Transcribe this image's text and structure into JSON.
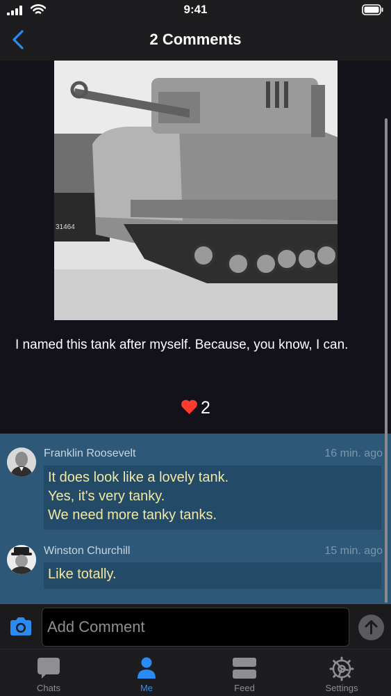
{
  "status_bar": {
    "time": "9:41"
  },
  "nav": {
    "title": "2 Comments"
  },
  "post": {
    "text": "I named this tank after myself. Because, you know, I can.",
    "like_count": "2",
    "image_text": "31464"
  },
  "comments": [
    {
      "author": "Franklin Roosevelt",
      "time": "16 min. ago",
      "lines": [
        "It does look like a lovely tank.",
        "Yes, it's very tanky.",
        "We need more tanky tanks."
      ]
    },
    {
      "author": "Winston Churchill",
      "time": "15 min. ago",
      "lines": [
        "Like totally."
      ]
    }
  ],
  "composer": {
    "placeholder": "Add Comment"
  },
  "tabs": [
    {
      "label": "Chats",
      "icon": "chat-icon"
    },
    {
      "label": "Me",
      "icon": "person-icon"
    },
    {
      "label": "Feed",
      "icon": "feed-icon"
    },
    {
      "label": "Settings",
      "icon": "gear-icon"
    }
  ],
  "colors": {
    "accent": "#2a8cf3",
    "heart": "#ff3b30",
    "comment_background": "#2d5878",
    "comment_text": "#f3e8a2"
  }
}
